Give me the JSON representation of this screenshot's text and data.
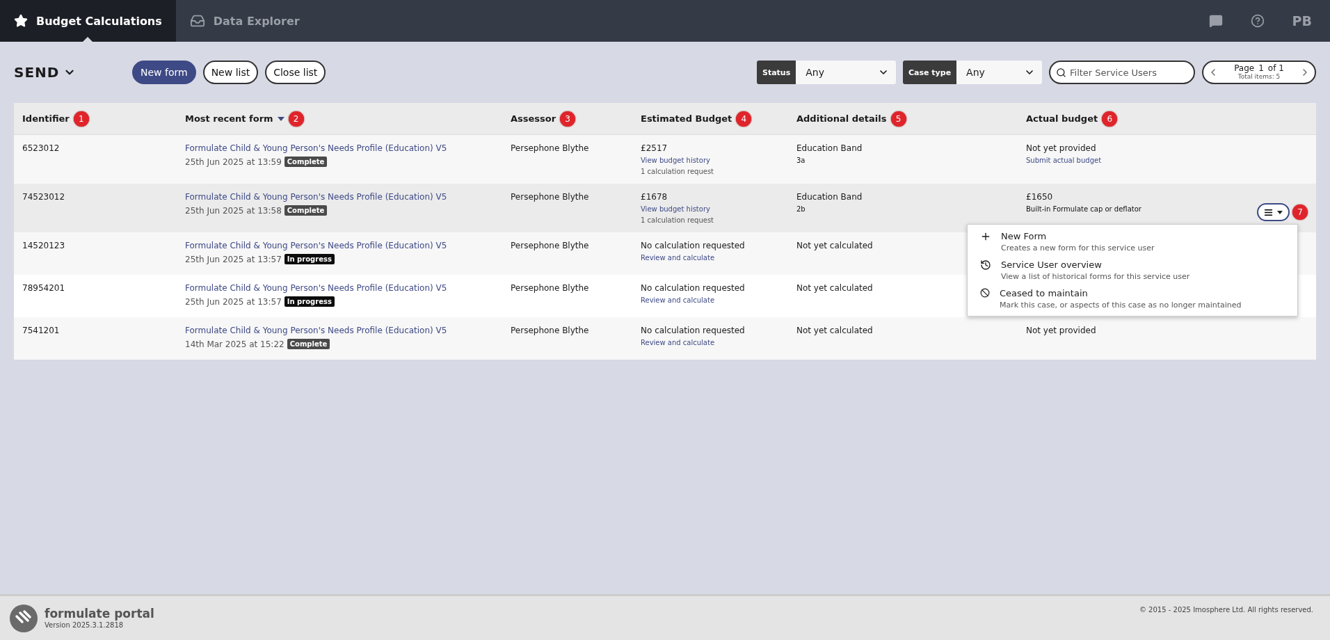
{
  "nav": {
    "tabs": [
      {
        "label": "Budget Calculations",
        "kind": "budget",
        "selected": true
      },
      {
        "label": "Data Explorer",
        "kind": "explorer",
        "selected": false
      }
    ],
    "initials": "PB"
  },
  "toolbar": {
    "title": "SEND",
    "buttons": [
      {
        "label": "New form",
        "kind": "primary"
      },
      {
        "label": "New list",
        "kind": "outline"
      },
      {
        "label": "Close list",
        "kind": "outline"
      }
    ],
    "filters": [
      {
        "label": "Status",
        "value": "Any"
      },
      {
        "label": "Case type",
        "value": "Any"
      }
    ],
    "search": {
      "placeholder": "Filter Service Users"
    },
    "pager": {
      "page_label": "Page",
      "page": "1",
      "of": "of 1",
      "total": "Total items: 5"
    }
  },
  "table": {
    "columns": [
      {
        "label": "Identifier",
        "badge": "1",
        "sorted": false
      },
      {
        "label": "Most recent form",
        "badge": "2",
        "sorted": true
      },
      {
        "label": "Assessor",
        "badge": "3",
        "sorted": false
      },
      {
        "label": "Estimated Budget",
        "badge": "4",
        "sorted": false
      },
      {
        "label": "Additional details",
        "badge": "5",
        "sorted": false
      },
      {
        "label": "Actual budget",
        "badge": "6",
        "sorted": false
      }
    ],
    "rows": [
      {
        "identifier": "6523012",
        "form": "Formulate Child & Young Person's Needs Profile (Education) V5",
        "date": "25th Jun 2025 at 13:59",
        "status": {
          "label": "Complete",
          "kind": "complete"
        },
        "assessor": "Persephone Blythe",
        "estimate": {
          "amount": "£2517",
          "link": "View budget history",
          "note": "1 calculation request"
        },
        "details": {
          "label": "Education Band",
          "value": "3a"
        },
        "actual": {
          "amount": "Not yet provided",
          "link": "Submit actual budget"
        },
        "highlighted": false
      },
      {
        "identifier": "74523012",
        "form": "Formulate Child & Young Person's Needs Profile (Education) V5",
        "date": "25th Jun 2025 at 13:58",
        "status": {
          "label": "Complete",
          "kind": "complete"
        },
        "assessor": "Persephone Blythe",
        "estimate": {
          "amount": "£1678",
          "link": "View budget history",
          "note": "1 calculation request"
        },
        "details": {
          "label": "Education Band",
          "value": "2b"
        },
        "actual": {
          "amount": "£1650",
          "note": "Built-in Formulate cap or deflator"
        },
        "highlighted": true,
        "menu": {
          "badge": "7",
          "items": [
            {
              "kind": "add",
              "title": "New Form",
              "description": "Creates a new form for this service user"
            },
            {
              "kind": "history",
              "title": "Service User overview",
              "description": "View a list of historical forms for this service user"
            },
            {
              "kind": "cease",
              "title": "Ceased to maintain",
              "description": "Mark this case, or aspects of this case as no longer maintained"
            }
          ]
        }
      },
      {
        "identifier": "14520123",
        "form": "Formulate Child & Young Person's Needs Profile (Education) V5",
        "date": "25th Jun 2025 at 13:57",
        "status": {
          "label": "In progress",
          "kind": "in_progress"
        },
        "assessor": "Persephone Blythe",
        "estimate": {
          "amount": "No calculation requested",
          "link": "Review and calculate"
        },
        "details": {
          "label": "Not yet calculated"
        },
        "highlighted": false
      },
      {
        "identifier": "78954201",
        "form": "Formulate Child & Young Person's Needs Profile (Education) V5",
        "date": "25th Jun 2025 at 13:57",
        "status": {
          "label": "In progress",
          "kind": "in_progress"
        },
        "assessor": "Persephone Blythe",
        "estimate": {
          "amount": "No calculation requested",
          "link": "Review and calculate"
        },
        "details": {
          "label": "Not yet calculated"
        },
        "highlighted": false
      },
      {
        "identifier": "7541201",
        "form": "Formulate Child & Young Person's Needs Profile (Education) V5",
        "date": "14th Mar 2025 at 15:22",
        "status": {
          "label": "Complete",
          "kind": "complete"
        },
        "assessor": "Persephone Blythe",
        "estimate": {
          "amount": "No calculation requested",
          "link": "Review and calculate"
        },
        "details": {
          "label": "Not yet calculated"
        },
        "actual": {
          "amount": "Not yet provided"
        },
        "highlighted": false
      }
    ]
  },
  "footer": {
    "brand": "formulate portal",
    "version": "Version 2025.3.1.2818",
    "copyright": "© 2015 - 2025 Imosphere Ltd. All rights reserved."
  }
}
